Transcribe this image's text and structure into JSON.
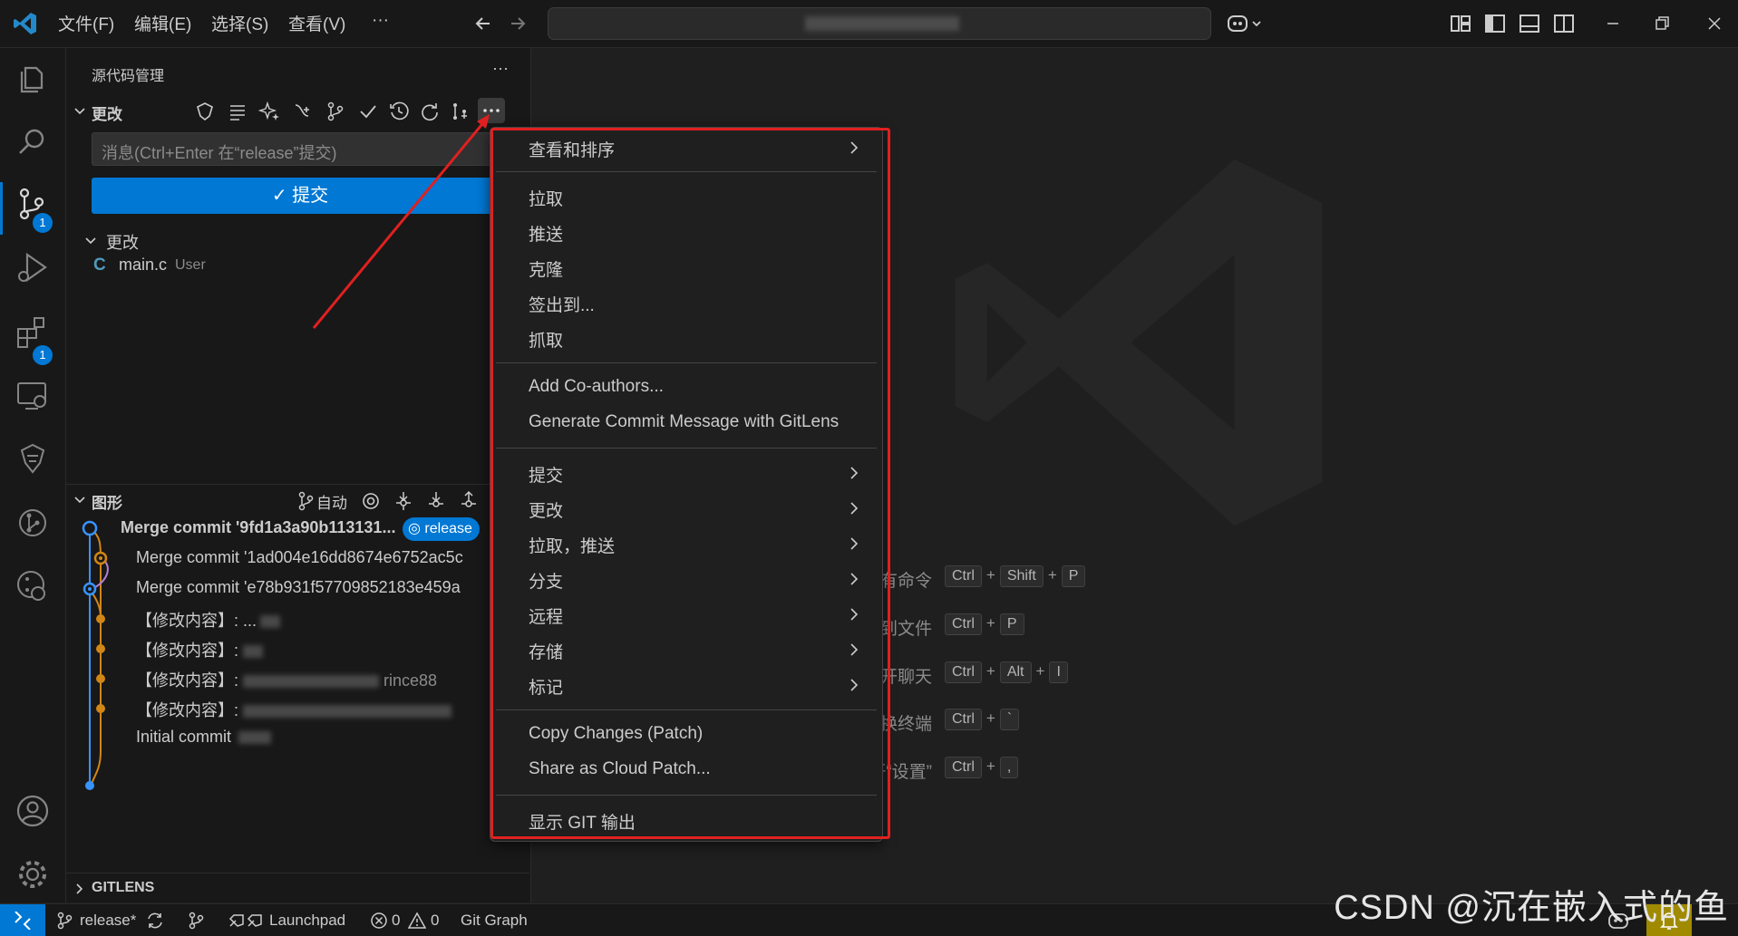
{
  "titlebar": {
    "menus": [
      "文件(F)",
      "编辑(E)",
      "选择(S)",
      "查看(V)",
      "···"
    ]
  },
  "activity": {
    "scm_badge": "1",
    "ext_badge": "1"
  },
  "sidebar": {
    "title": "源代码管理",
    "more": "···",
    "changes_header": "更改",
    "commit_placeholder": "消息(Ctrl+Enter 在“release”提交)",
    "commit_button": "提交",
    "changes_group": "更改",
    "file": {
      "lang": "C",
      "name": "main.c",
      "meta": "User"
    },
    "graph_header": "图形",
    "graph_auto": "自动",
    "graph_rows": [
      "Merge commit '9fd1a3a90b113131...",
      "Merge commit '1ad004e16dd8674e6752ac5c",
      "Merge commit 'e78b931f57709852183e459a",
      "【修改内容】: ...",
      "【修改内容】: ",
      "【修改内容】: ",
      "【修改内容】: ",
      "Initial commit"
    ],
    "row_frag_rince": "rince88",
    "release_tag": "release",
    "gitlens": "GITLENS"
  },
  "context_menu": {
    "group1": [
      {
        "label": "查看和排序",
        "sub": true
      }
    ],
    "group2": [
      "拉取",
      "推送",
      "克隆",
      "签出到...",
      "抓取"
    ],
    "group3": [
      "Add Co-authors...",
      "Generate Commit Message with GitLens"
    ],
    "group4": [
      "提交",
      "更改",
      "拉取，推送",
      "分支",
      "远程",
      "存储",
      "标记"
    ],
    "group5": [
      "Copy Changes (Patch)",
      "Share as Cloud Patch..."
    ],
    "group6": [
      "显示 GIT 输出"
    ]
  },
  "editor_hints": [
    {
      "label": "显示所有命令",
      "keys": [
        "Ctrl",
        "Shift",
        "P"
      ]
    },
    {
      "label": "转到文件",
      "keys": [
        "Ctrl",
        "P"
      ]
    },
    {
      "label": "打开聊天",
      "keys": [
        "Ctrl",
        "Alt",
        "I"
      ]
    },
    {
      "label": "切换终端",
      "keys": [
        "Ctrl",
        "`"
      ]
    },
    {
      "label": "打开“设置”",
      "keys": [
        "Ctrl",
        ","
      ]
    }
  ],
  "statusbar": {
    "branch": "release*",
    "launchpad": "Launchpad",
    "errors": "0",
    "warnings": "0",
    "git_graph": "Git Graph"
  },
  "watermark": "CSDN @沉在嵌入式的鱼",
  "colors": {
    "accent": "#0078d4",
    "highlight_box": "#e02020",
    "graph_blue": "#3794ff",
    "graph_orange": "#d18616",
    "graph_purple": "#b180d7"
  }
}
